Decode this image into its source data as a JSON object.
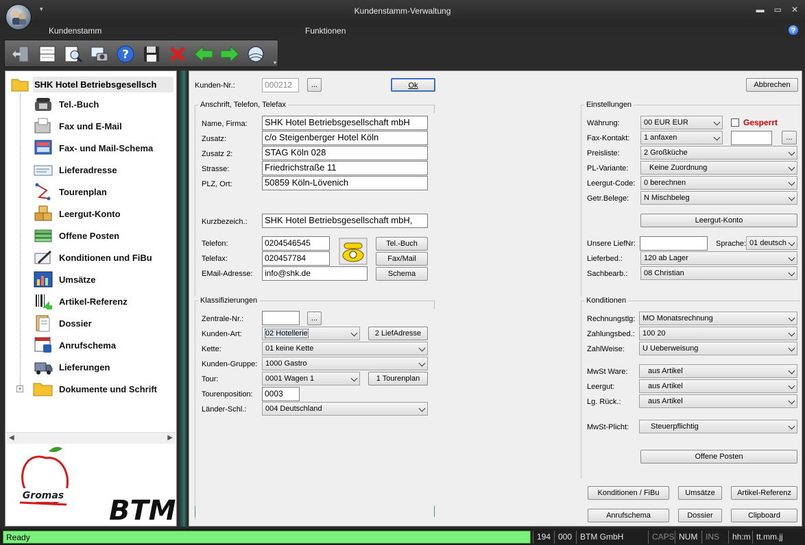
{
  "window": {
    "title": "Kundenstamm-Verwaltung"
  },
  "menu": {
    "items": [
      "Kundenstamm",
      "Funktionen"
    ]
  },
  "sidebar": {
    "root": "SHK Hotel Betriebsgesellsch",
    "items": [
      {
        "label": "Tel.-Buch",
        "icon": "telephone-icon"
      },
      {
        "label": "Fax und E-Mail",
        "icon": "fax-icon"
      },
      {
        "label": "Fax- und Mail-Schema",
        "icon": "schema-icon"
      },
      {
        "label": "Lieferadresse",
        "icon": "address-card-icon"
      },
      {
        "label": "Tourenplan",
        "icon": "route-icon"
      },
      {
        "label": "Leergut-Konto",
        "icon": "boxes-icon"
      },
      {
        "label": "Offene Posten",
        "icon": "money-icon"
      },
      {
        "label": "Konditionen und FiBu",
        "icon": "pen-icon"
      },
      {
        "label": "Umsätze",
        "icon": "chart-icon"
      },
      {
        "label": "Artikel-Referenz",
        "icon": "barcode-icon"
      },
      {
        "label": "Dossier",
        "icon": "dossier-icon"
      },
      {
        "label": "Anrufschema",
        "icon": "call-schema-icon"
      },
      {
        "label": "Lieferungen",
        "icon": "truck-icon"
      },
      {
        "label": "Dokumente und Schrift",
        "icon": "folder-icon"
      }
    ],
    "logos": {
      "gromas": "Gromas",
      "btm": "BTM"
    }
  },
  "form": {
    "kunden_nr_label": "Kunden-Nr.:",
    "kunden_nr": "000212",
    "ellipsis": "...",
    "ok": "Ok",
    "abbrechen": "Abbrechen",
    "anschrift": {
      "title": "Anschrift, Telefon, Telefax",
      "name_label": "Name, Firma:",
      "name": "SHK Hotel Betriebsgesellschaft mbH",
      "zusatz_label": "Zusatz:",
      "zusatz": "c/o Steigenberger Hotel Köln",
      "zusatz2_label": "Zusatz 2:",
      "zusatz2": "STAG Köln 028",
      "strasse_label": "Strasse:",
      "strasse": "Friedrichstraße 11",
      "plz_label": "PLZ, Ort:",
      "plz": "50859 Köln-Lövenich",
      "kurz_label": "Kurzbezeich.:",
      "kurz": "SHK Hotel Betriebsgesellschaft mbH,",
      "telefon_label": "Telefon:",
      "telefon": "0204546545",
      "telefax_label": "Telefax:",
      "telefax": "020457784",
      "email_label": "EMail-Adresse:",
      "email": "info@shk.de",
      "telbuch_btn": "Tel.-Buch",
      "faxmail_btn": "Fax/Mail",
      "schema_btn": "Schema"
    },
    "klassifizierungen": {
      "title": "Klassifizierungen",
      "zentrale_label": "Zentrale-Nr.:",
      "zentrale": "",
      "kundenart_label": "Kunden-Art:",
      "kundenart": "02 Hotellerie",
      "liefadresse_btn": "2 LiefAdresse",
      "kette_label": "Kette:",
      "kette": "01 keine Kette",
      "gruppe_label": "Kunden-Gruppe:",
      "gruppe": "1000 Gastro",
      "tour_label": "Tour:",
      "tour": "0001 Wagen 1",
      "tourenplan_btn": "1 Tourenplan",
      "tourpos_label": "Tourenposition:",
      "tourpos": "0003",
      "laender_label": "Länder-Schl.:",
      "laender": "004 Deutschland"
    },
    "einstellungen": {
      "title": "Einstellungen",
      "waehrung_label": "Währung:",
      "waehrung": "00 EUR EUR",
      "gesperrt": "Gesperrt",
      "faxkontakt_label": "Fax-Kontakt:",
      "faxkontakt": "1 anfaxen",
      "preisliste_label": "Preisliste:",
      "preisliste": "2 Großküche",
      "plvariante_label": "PL-Variante:",
      "plvariante": "Keine Zuordnung",
      "leergutcode_label": "Leergut-Code:",
      "leergutcode": "0 berechnen",
      "getr_label": "Getr.Belege:",
      "getr": "N Mischbeleg",
      "leergutkonto_btn": "Leergut-Konto",
      "liefnr_label": "Unsere LiefNr:",
      "liefnr": "",
      "sprache_label": "Sprache:",
      "sprache": "01 deutsch",
      "lieferbed_label": "Lieferbed.:",
      "lieferbed": "120 ab Lager",
      "sachbearb_label": "Sachbearb.:",
      "sachbearb": "08 Christian"
    },
    "konditionen": {
      "title": "Konditionen",
      "rechnung_label": "Rechnungstlg:",
      "rechnung": "MO Monatsrechnung",
      "zahlungsbed_label": "Zahlungsbed.:",
      "zahlungsbed": "100 20",
      "zahlweise_label": "ZahlWeise:",
      "zahlweise": "U Ueberweisung",
      "mwstware_label": "MwSt Ware:",
      "mwstware": "aus Artikel",
      "leergut_label": "Leergut:",
      "leergut": "aus Artikel",
      "lgrueck_label": "Lg. Rück.:",
      "lgrueck": "aus Artikel",
      "mwstpflicht_label": "MwSt-Plicht:",
      "mwstpflicht": "Steuerpflichtig",
      "offeneposten_btn": "Offene Posten"
    },
    "bottom_buttons": {
      "konditionen": "Konditionen / FiBu",
      "umsaetze": "Umsätze",
      "artikelref": "Artikel-Referenz",
      "anrufschema": "Anrufschema",
      "dossier": "Dossier",
      "clipboard": "Clipboard"
    }
  },
  "statusbar": {
    "ready": "Ready",
    "p1": "194",
    "p2": "000",
    "p3": "BTM GmbH",
    "caps": "CAPS",
    "num": "NUM",
    "ins": "INS",
    "time": "hh:m",
    "date": "tt.mm.jj"
  },
  "colors": {
    "status_green": "#7cf07c",
    "gesperrt_red": "#d40000",
    "splitter_teal": "#2b7a6a"
  }
}
